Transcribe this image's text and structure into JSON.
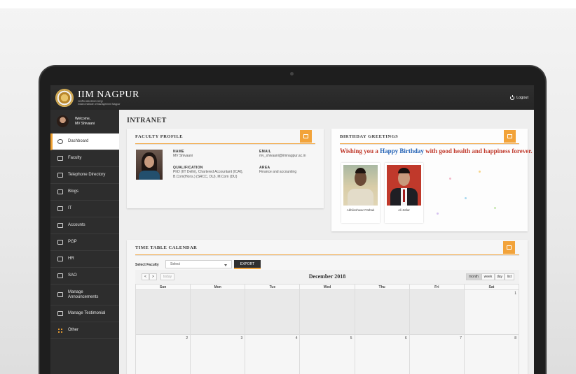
{
  "header": {
    "logo_title": "IIM NAGPUR",
    "logo_sub_1": "भारतीय प्रबंध संस्थान नागपुर",
    "logo_sub_2": "Indian Institute of Management Nagpur",
    "logout_label": "Logout"
  },
  "sidebar": {
    "welcome_label": "Welcome,",
    "user_name": "MV Shivaani",
    "items": [
      {
        "label": "Dashboard",
        "icon": "dashboard-icon"
      },
      {
        "label": "Faculty",
        "icon": "faculty-icon"
      },
      {
        "label": "Telephone Directory",
        "icon": "telephone-icon"
      },
      {
        "label": "Blogs",
        "icon": "blogs-icon"
      },
      {
        "label": "IT",
        "icon": "monitor-icon"
      },
      {
        "label": "Accounts",
        "icon": "accounts-icon"
      },
      {
        "label": "PGP",
        "icon": "pgp-icon"
      },
      {
        "label": "HR",
        "icon": "hr-icon"
      },
      {
        "label": "SAO",
        "icon": "sao-icon"
      },
      {
        "label": "Manage Announcements",
        "icon": "megaphone-icon"
      },
      {
        "label": "Manage Testimonial",
        "icon": "testimonial-icon"
      },
      {
        "label": "Other",
        "icon": "grid-icon"
      }
    ]
  },
  "main": {
    "page_title": "INTRANET",
    "faculty_profile": {
      "title": "FACULTY PROFILE",
      "name_label": "NAME",
      "name_value": "MV Shivaani",
      "email_label": "EMAIL",
      "email_value": "mv_shivaani@iimnagpur.ac.in",
      "qualification_label": "QUALIFICATION",
      "qualification_value": "PhD (IIT Delhi), Chartered Accountant (ICAI), B.Com(Hons.) (SRCC, DU), M.Com (DU)",
      "area_label": "AREA",
      "area_value": "Finance and accounting"
    },
    "birthday": {
      "title": "BIRTHDAY GREETINGS",
      "msg_before": "Wishing you a ",
      "msg_highlight": "Happy Birthday",
      "msg_after": " with good health and happiness forever.",
      "people": [
        {
          "name": "Akhileshwar Pathak"
        },
        {
          "name": "Ali Zafar"
        }
      ]
    },
    "timetable": {
      "title": "TIME TABLE CALENDAR",
      "select_faculty_label": "Select Faculty",
      "select_value": "Select",
      "export_label": "EXPORT",
      "prev_label": "<",
      "next_label": ">",
      "today_label": "today",
      "month_title": "December 2018",
      "views": [
        "month",
        "week",
        "day",
        "list"
      ],
      "days": [
        "Sun",
        "Mon",
        "Tue",
        "Wed",
        "Thu",
        "Fri",
        "Sat"
      ],
      "weeks": [
        [
          "",
          "",
          "",
          "",
          "",
          "",
          "1"
        ],
        [
          "2",
          "3",
          "4",
          "5",
          "6",
          "7",
          "8"
        ]
      ]
    }
  },
  "colors": {
    "accent": "#f2a33a",
    "header_bg": "#2f2f2f",
    "sidebar_bg": "#2d2d2d",
    "birthday_red": "#c0392b",
    "birthday_blue": "#1f5fb4"
  }
}
